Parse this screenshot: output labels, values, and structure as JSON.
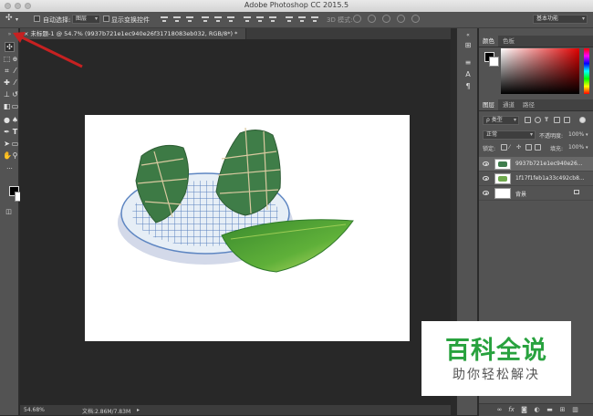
{
  "window": {
    "title": "Adobe Photoshop CC 2015.5"
  },
  "options_bar": {
    "auto_select_label": "自动选择:",
    "auto_select_value": "图层",
    "show_transform_label": "显示变换控件",
    "mode_3d_label": "3D 模式:",
    "workspace_value": "基本功能"
  },
  "document_tab": {
    "close": "×",
    "title": "未标题-1 @ 54.7% (9937b721e1ec940e26f31718083eb032, RGB/8*) *"
  },
  "status_bar": {
    "zoom": "54.68%",
    "doc_info": "文档:2.86M/7.83M"
  },
  "color_panel": {
    "tabs": [
      "颜色",
      "色板"
    ]
  },
  "layers_panel": {
    "tabs": [
      "图层",
      "通道",
      "路径"
    ],
    "kind_filter": "ρ 类型",
    "blend_mode": "正常",
    "opacity_label": "不透明度:",
    "opacity_value": "100%",
    "lock_label": "锁定:",
    "fill_label": "填充:",
    "fill_value": "100%",
    "layers": [
      {
        "name": "9937b721e1ec940e26...",
        "selected": true
      },
      {
        "name": "1f17f1feb1a33c492cb8...",
        "selected": false
      },
      {
        "name": "背景",
        "selected": false,
        "locked": true
      }
    ],
    "bottom_icons": [
      "link-icon",
      "fx-icon",
      "mask-icon",
      "adjustment-icon",
      "folder-icon",
      "new-layer-icon",
      "trash-icon"
    ]
  },
  "toolbar": {
    "tools": [
      "move-tool",
      "marquee-tool",
      "lasso-tool",
      "quick-select-tool",
      "crop-tool",
      "eyedropper-tool",
      "healing-brush-tool",
      "brush-tool",
      "clone-stamp-tool",
      "history-brush-tool",
      "eraser-tool",
      "gradient-tool",
      "blur-tool",
      "dodge-tool",
      "pen-tool",
      "type-tool",
      "path-select-tool",
      "rectangle-tool",
      "hand-tool",
      "zoom-tool"
    ],
    "foreground_color": "#000000",
    "background_color": "#ffffff"
  },
  "watermark": {
    "title": "百科全说",
    "subtitle": "助你轻松解决",
    "color": "#28a23e"
  },
  "annotation": {
    "arrow_color": "#c62121"
  }
}
